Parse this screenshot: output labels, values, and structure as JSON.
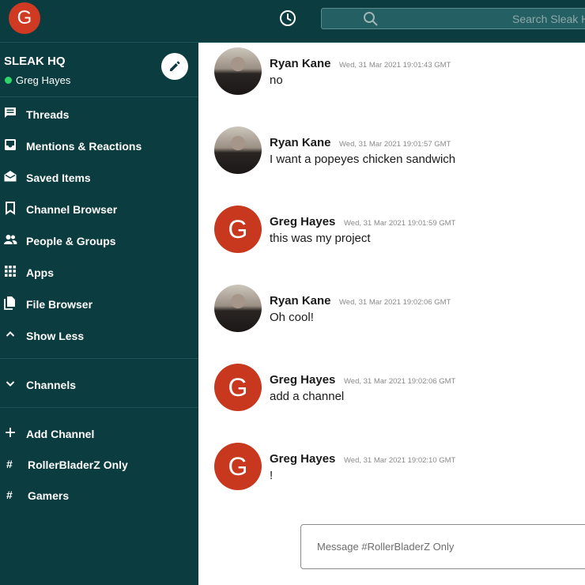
{
  "topbar": {
    "user_initial": "G",
    "search_placeholder": "Search Sleak HQ"
  },
  "workspace": {
    "name": "SLEAK HQ",
    "current_user": "Greg Hayes",
    "presence_color": "#2fd46a"
  },
  "sidebar": {
    "nav": [
      {
        "label": "Threads",
        "icon": "threads-icon"
      },
      {
        "label": "Mentions & Reactions",
        "icon": "inbox-icon"
      },
      {
        "label": "Saved Items",
        "icon": "drafts-icon"
      },
      {
        "label": "Channel Browser",
        "icon": "bookmark-icon"
      },
      {
        "label": "People & Groups",
        "icon": "people-icon"
      },
      {
        "label": "Apps",
        "icon": "apps-grid-icon"
      },
      {
        "label": "File Browser",
        "icon": "file-copy-icon"
      },
      {
        "label": "Show Less",
        "icon": "chevron-up-icon"
      }
    ],
    "channels_header": "Channels",
    "add_channel": "Add Channel",
    "channels": [
      {
        "hash": "#",
        "name": "RollerBladerZ Only"
      },
      {
        "hash": "#",
        "name": "Gamers"
      }
    ]
  },
  "messages": [
    {
      "author": "Ryan Kane",
      "time": "Wed, 31 Mar 2021 19:01:43 GMT",
      "text": "no",
      "avatar": "photo"
    },
    {
      "author": "Ryan Kane",
      "time": "Wed, 31 Mar 2021 19:01:57 GMT",
      "text": "I want a popeyes chicken sandwich",
      "avatar": "photo"
    },
    {
      "author": "Greg Hayes",
      "time": "Wed, 31 Mar 2021 19:01:59 GMT",
      "text": "this was my project",
      "avatar": "G"
    },
    {
      "author": "Ryan Kane",
      "time": "Wed, 31 Mar 2021 19:02:06 GMT",
      "text": "Oh cool!",
      "avatar": "photo"
    },
    {
      "author": "Greg Hayes",
      "time": "Wed, 31 Mar 2021 19:02:06 GMT",
      "text": "add a channel",
      "avatar": "G"
    },
    {
      "author": "Greg Hayes",
      "time": "Wed, 31 Mar 2021 19:02:10 GMT",
      "text": "!",
      "avatar": "G"
    }
  ],
  "composer": {
    "placeholder": "Message #RollerBladerZ Only"
  },
  "colors": {
    "sidebar_bg": "#0b3c40",
    "avatar_red": "#c8381f"
  }
}
